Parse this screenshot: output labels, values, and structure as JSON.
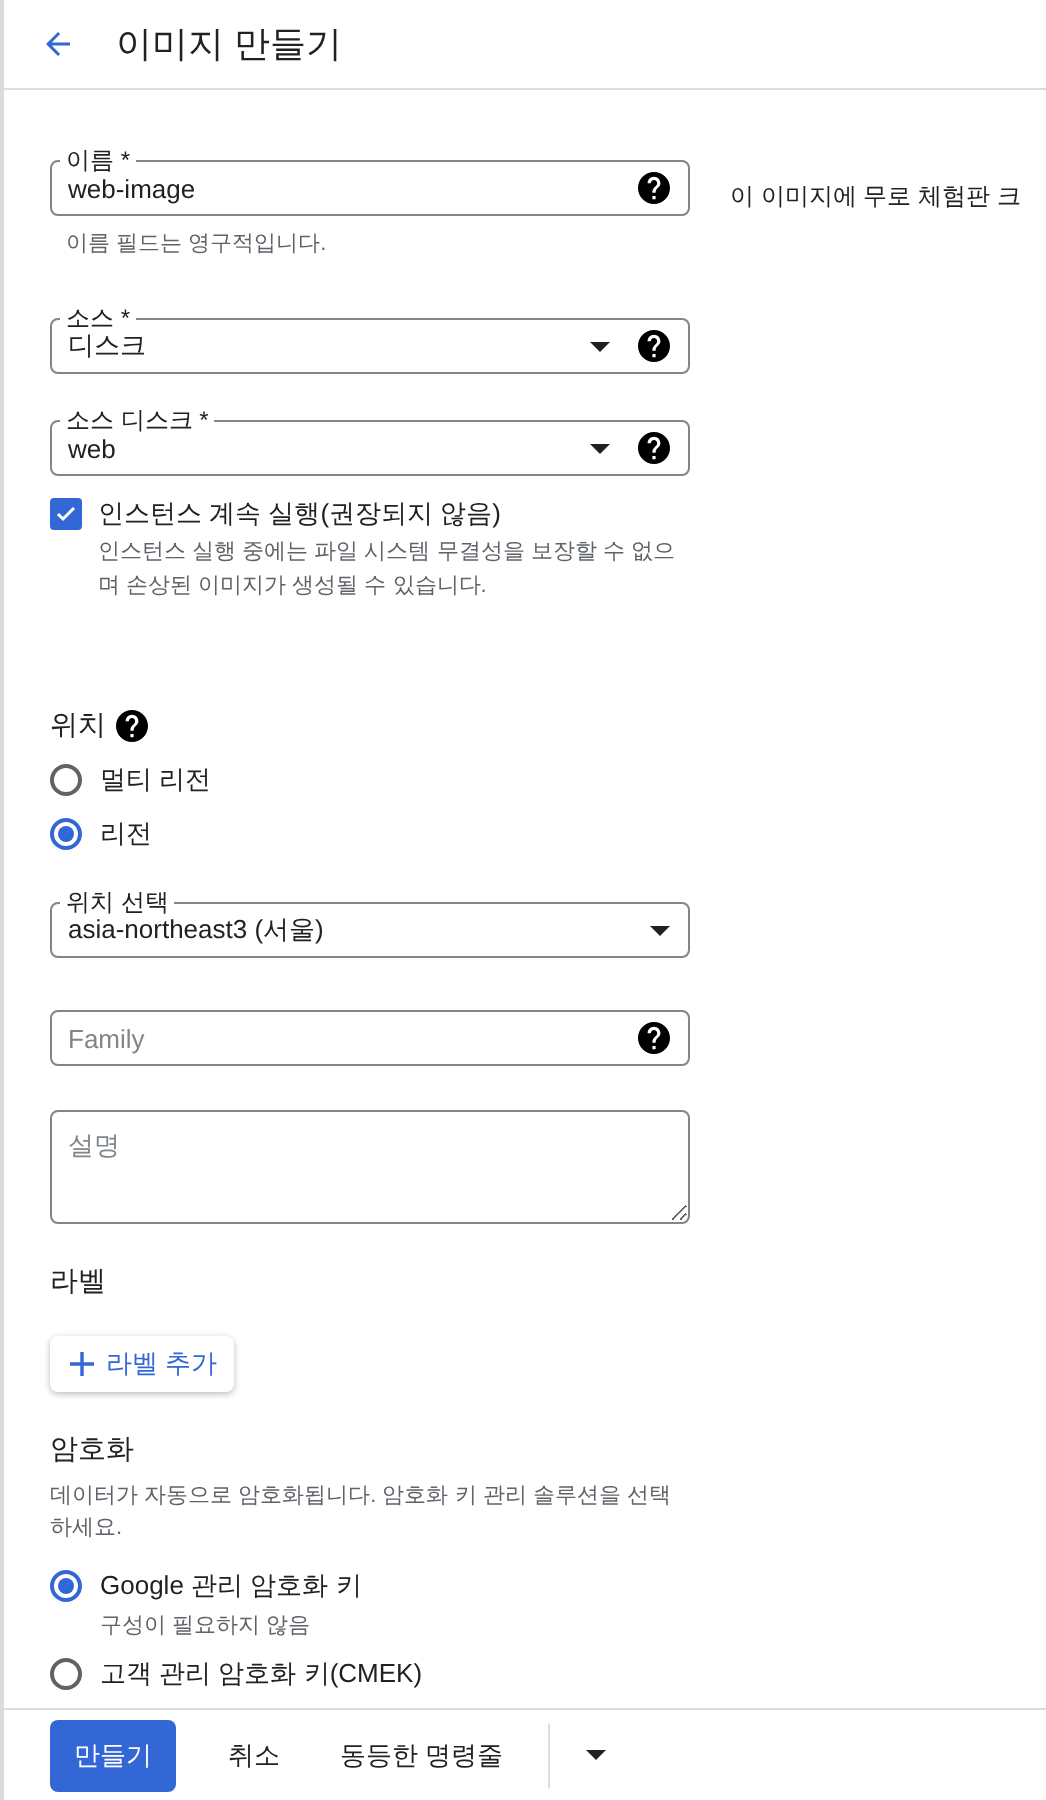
{
  "header": {
    "title": "이미지 만들기"
  },
  "side_note": "이 이미지에 무로 체험판 크",
  "fields": [
    {
      "kind": "text",
      "label": "이름 *",
      "value": "web-image",
      "help": true,
      "helper": "이름 필드는 영구적입니다."
    },
    {
      "kind": "select",
      "label": "소스 *",
      "value": "디스크",
      "help": true
    },
    {
      "kind": "select",
      "label": "소스 디스크 *",
      "value": "web",
      "help": true
    }
  ],
  "keep_running": {
    "label": "인스턴스 계속 실행(권장되지 않음)",
    "checked": true,
    "description": "인스턴스 실행 중에는 파일 시스템 무결성을 보장할 수 없으며 손상된 이미지가 생성될 수 있습니다."
  },
  "location": {
    "heading": "위치",
    "help": true,
    "options": [
      {
        "label": "멀티 리전",
        "selected": false
      },
      {
        "label": "리전",
        "selected": true
      }
    ],
    "select": {
      "label": "위치 선택",
      "value": "asia-northeast3 (서울)"
    }
  },
  "family": {
    "placeholder": "Family",
    "help": true
  },
  "description": {
    "placeholder": "설명"
  },
  "labels": {
    "heading": "라벨",
    "add_button": "라벨 추가"
  },
  "encryption": {
    "heading": "암호화",
    "description": "데이터가 자동으로 암호화됩니다. 암호화 키 관리 솔루션을 선택하세요.",
    "options": [
      {
        "label": "Google 관리 암호화 키",
        "sublabel": "구성이 필요하지 않음",
        "selected": true
      },
      {
        "label": "고객 관리 암호화 키(CMEK)",
        "selected": false
      }
    ]
  },
  "footer": {
    "buttons": [
      {
        "kind": "primary",
        "label": "만들기"
      },
      {
        "kind": "text",
        "label": "취소"
      },
      {
        "kind": "text",
        "label": "동등한 명령줄"
      }
    ]
  }
}
